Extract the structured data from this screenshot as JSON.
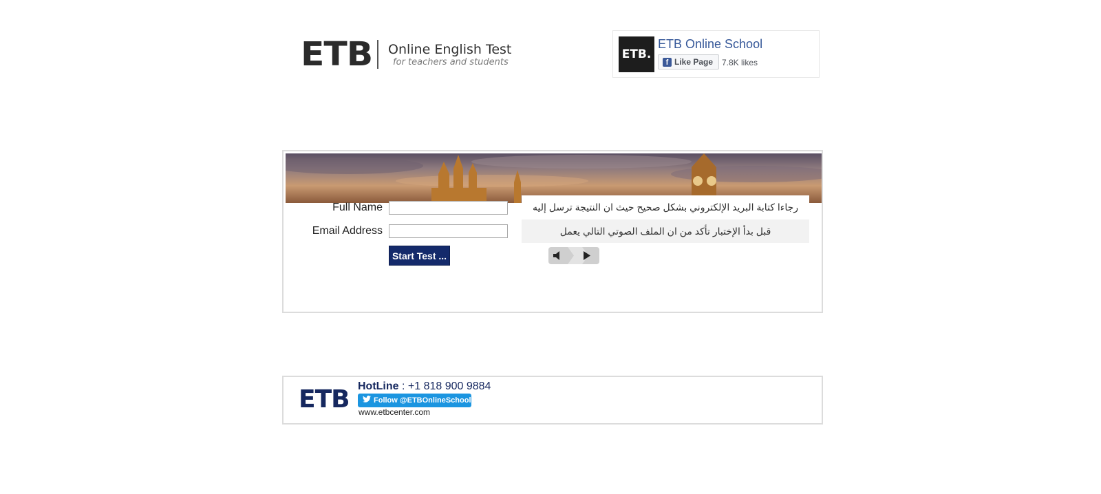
{
  "header": {
    "logo_text": "ETB",
    "title": "Online English Test",
    "tagline": "for teachers and students"
  },
  "facebook": {
    "thumb_text": "ETB.",
    "page_name": "ETB Online School",
    "like_button": "Like Page",
    "likes": "7.8K likes",
    "brand_color": "#3b5998"
  },
  "form": {
    "full_name_label": "Full Name",
    "full_name_value": "",
    "email_label": "Email Address",
    "email_value": "",
    "start_button": "Start Test ..."
  },
  "notices": {
    "email_notice": "رجاءا كتابة البريد الإلكتروني بشكل صحيح حيث ان النتيجة ترسل إليه",
    "audio_notice": "قبل بدأ الإختبار تأكد من ان الملف الصوتي التالي يعمل"
  },
  "audio_player": {
    "icons": [
      "volume-icon",
      "play-icon"
    ]
  },
  "footer": {
    "logo_text": "ETB",
    "hotline_label": "HotLine",
    "hotline_number": " : +1 818 900 9884",
    "twitter_button": "Follow @ETBOnlineSchool",
    "website": "www.etbcenter.com",
    "accent_color": "#16285f",
    "twitter_color": "#1b95e0"
  }
}
